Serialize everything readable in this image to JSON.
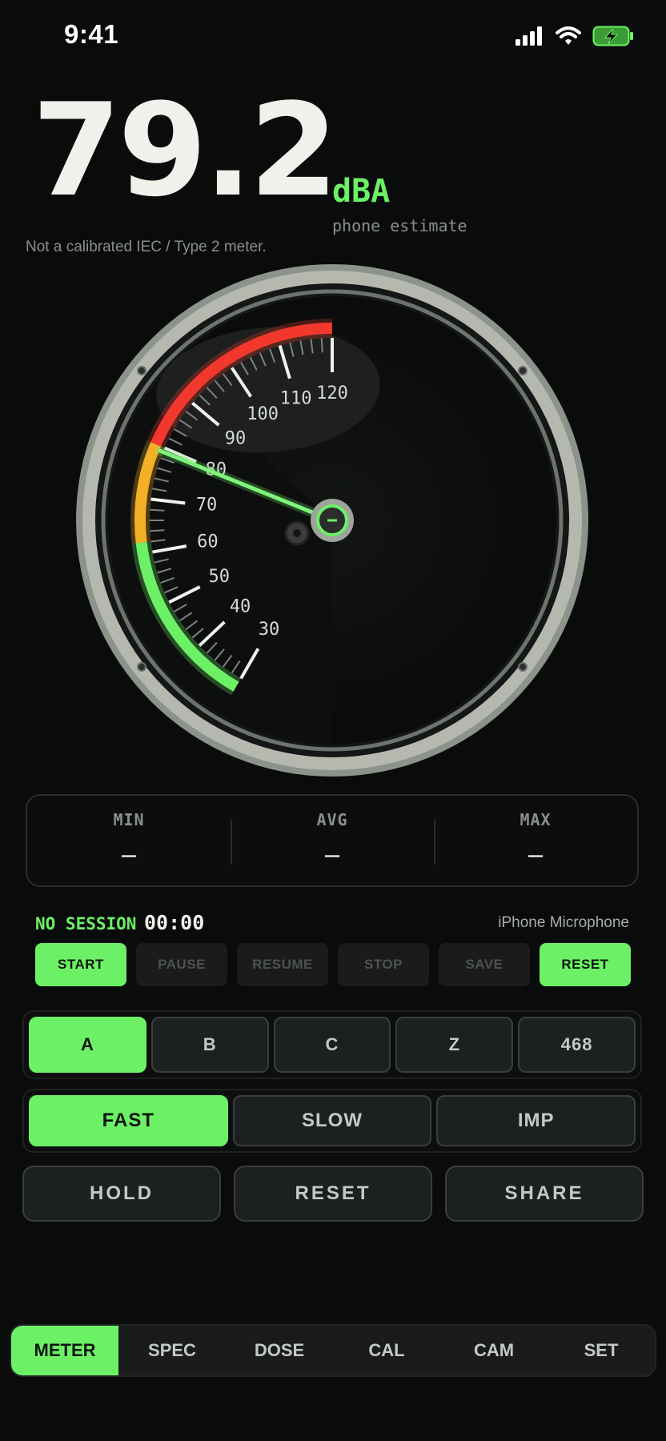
{
  "status": {
    "time": "9:41",
    "icons": [
      "signal-icon",
      "wifi-icon",
      "battery-charging-icon"
    ]
  },
  "reading": {
    "value": "79.2",
    "unit": "dBA",
    "note": "phone estimate",
    "disclaimer": "Not a calibrated IEC / Type 2 meter."
  },
  "gauge": {
    "min": 30,
    "max": 120,
    "value": 79.2,
    "tick_labels": [
      "30",
      "40",
      "50",
      "60",
      "70",
      "80",
      "90",
      "100",
      "110",
      "120"
    ],
    "zones": [
      {
        "from": 30,
        "to": 62,
        "color": "#6cf166"
      },
      {
        "from": 62,
        "to": 80,
        "color": "#f4b027"
      },
      {
        "from": 80,
        "to": 120,
        "color": "#f2382c"
      }
    ]
  },
  "stats": [
    {
      "label": "MIN",
      "value": "—"
    },
    {
      "label": "AVG",
      "value": "—"
    },
    {
      "label": "MAX",
      "value": "—"
    }
  ],
  "session": {
    "state": "NO SESSION",
    "time": "00:00",
    "source": "iPhone Microphone",
    "buttons": [
      {
        "label": "START",
        "active": true
      },
      {
        "label": "PAUSE",
        "active": false
      },
      {
        "label": "RESUME",
        "active": false
      },
      {
        "label": "STOP",
        "active": false
      },
      {
        "label": "SAVE",
        "active": false
      },
      {
        "label": "RESET",
        "active": true
      }
    ]
  },
  "weighting": {
    "options": [
      "A",
      "B",
      "C",
      "Z",
      "468"
    ],
    "selected": "A"
  },
  "response": {
    "options": [
      "FAST",
      "SLOW",
      "IMP"
    ],
    "selected": "FAST"
  },
  "actions": [
    "HOLD",
    "RESET",
    "SHARE"
  ],
  "tabs": {
    "items": [
      "METER",
      "SPEC",
      "DOSE",
      "CAL",
      "CAM",
      "SET"
    ],
    "selected": "METER"
  },
  "colors": {
    "accent": "#6cf166",
    "warn": "#f4b027",
    "danger": "#f2382c",
    "background": "#0a0c0c"
  }
}
